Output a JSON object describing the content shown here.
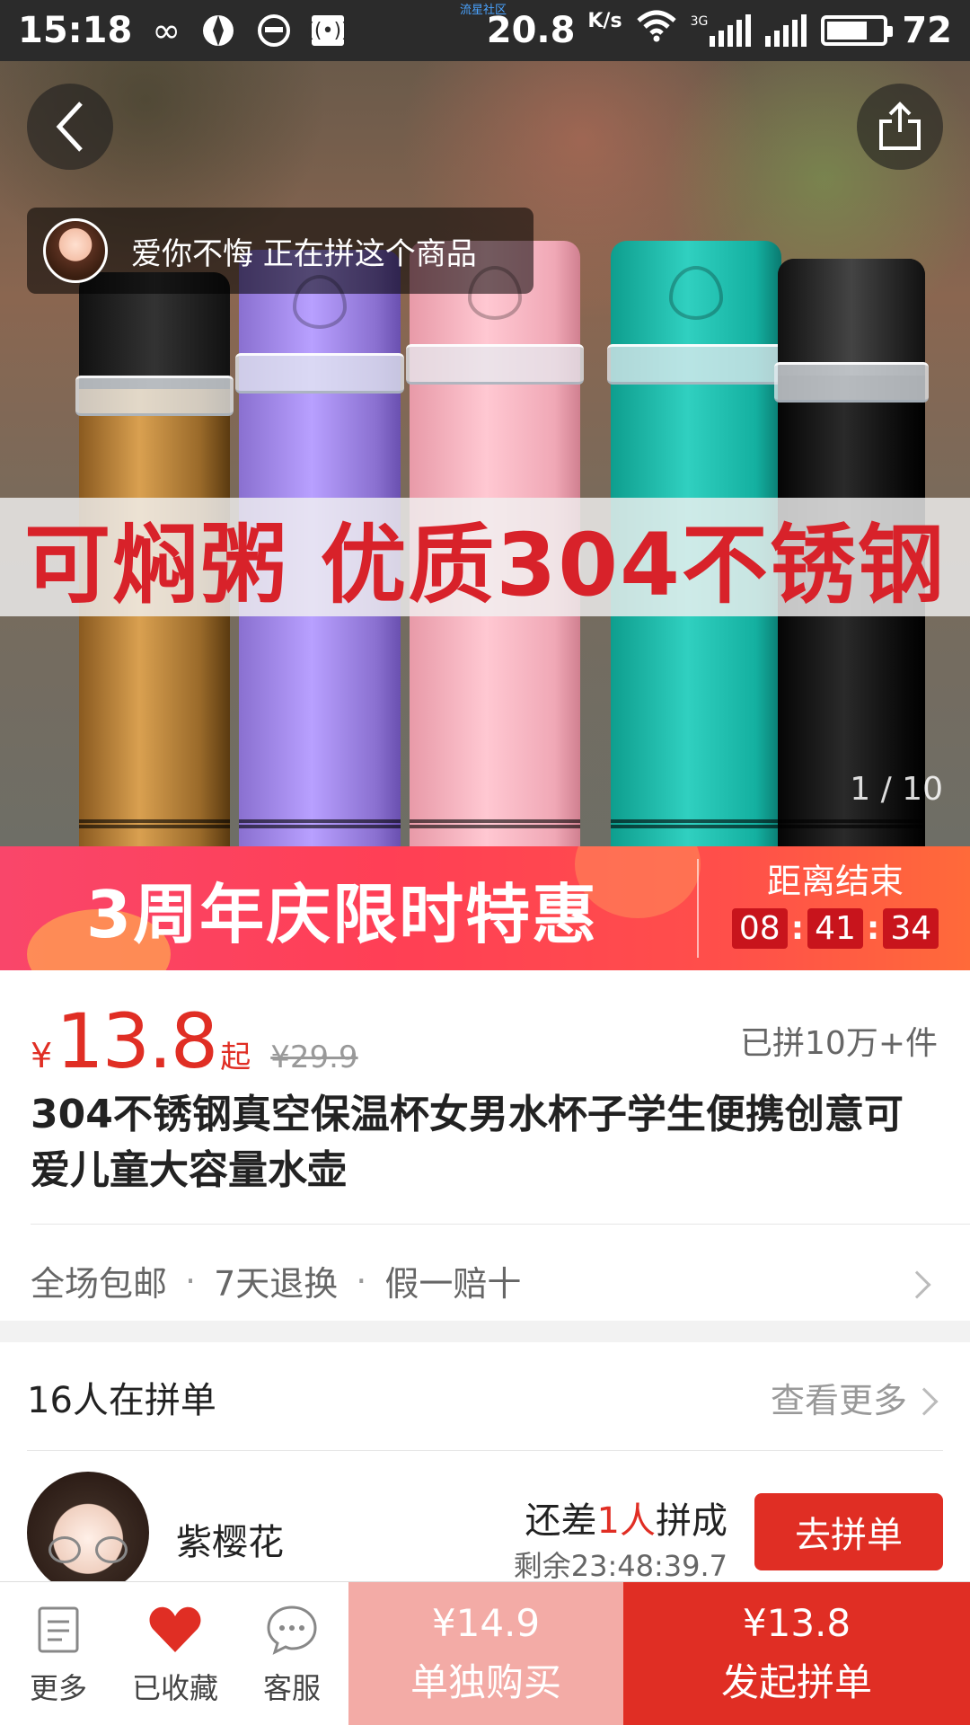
{
  "status_bar": {
    "time": "15:18",
    "tiny_text": "流星社区",
    "speed": "20.8",
    "speed_unit": "K/s",
    "network": "3G",
    "battery": "72",
    "battery_level": 0.72
  },
  "hero": {
    "joining_text": "爱你不悔 正在拼这个商品",
    "banner_text": "可焖粥 优质304不锈钢",
    "counter": "1 / 10"
  },
  "promo": {
    "title": "3周年庆限时特惠",
    "countdown_label": "距离结束",
    "hours": "08",
    "minutes": "41",
    "seconds": "34",
    "colors": {
      "banner": "#ff3f55",
      "digit_bg": "#c8141c"
    }
  },
  "product": {
    "currency": "¥",
    "price": "13.8",
    "price_suffix": "起",
    "original_price": "¥29.9",
    "sold": "已拼10万+件",
    "title": "304不锈钢真空保温杯女男水杯子学生便携创意可爱儿童大容量水壶",
    "services": [
      "全场包邮",
      "7天退换",
      "假一赔十"
    ],
    "service_separator": "·"
  },
  "group": {
    "heading": "16人在拼单",
    "more": "查看更多",
    "member": {
      "name": "紫樱花",
      "need_prefix": "还差",
      "need_count": "1人",
      "need_suffix": "拼成",
      "remaining": "剩余23:48:39.7",
      "join_label": "去拼单"
    }
  },
  "bottom_bar": {
    "more": "更多",
    "favorited": "已收藏",
    "service": "客服",
    "alone_price": "¥14.9",
    "alone_label": "单独购买",
    "group_price": "¥13.8",
    "group_label": "发起拼单",
    "colors": {
      "accent": "#e02e24",
      "alone_bg": "#f3aba6"
    }
  }
}
